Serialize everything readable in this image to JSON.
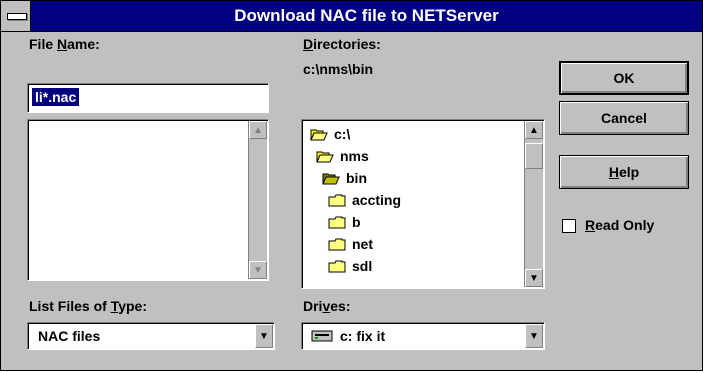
{
  "window": {
    "title": "Download NAC file to NETServer"
  },
  "file_name": {
    "label_pre": "File ",
    "label_ul": "N",
    "label_post": "ame:",
    "value": "li*.nac"
  },
  "directories": {
    "label_ul": "D",
    "label_post": "irectories:",
    "path": "c:\\nms\\bin",
    "items": [
      {
        "name": "c:\\",
        "icon": "open-folder-icon"
      },
      {
        "name": "nms",
        "icon": "open-folder-icon"
      },
      {
        "name": "bin",
        "icon": "open-folder-icon"
      },
      {
        "name": "accting",
        "icon": "folder-icon"
      },
      {
        "name": "b",
        "icon": "folder-icon"
      },
      {
        "name": "net",
        "icon": "folder-icon"
      },
      {
        "name": "sdl",
        "icon": "folder-icon"
      }
    ]
  },
  "list_type": {
    "label_pre": "List Files of ",
    "label_ul": "T",
    "label_post": "ype:",
    "value": "NAC files"
  },
  "drives": {
    "label_pre": "Dri",
    "label_ul": "v",
    "label_post": "es:",
    "value": "c: fix it",
    "icon": "drive-icon"
  },
  "buttons": {
    "ok": "OK",
    "cancel": "Cancel",
    "help_ul": "H",
    "help_post": "elp"
  },
  "read_only": {
    "label_ul": "R",
    "label_post": "ead Only",
    "checked": false
  },
  "colors": {
    "titlebar": "#000080",
    "face": "#c0c0c0",
    "selection": "#000080"
  }
}
